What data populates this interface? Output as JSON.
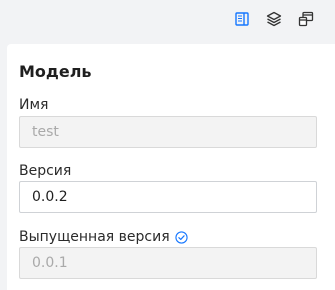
{
  "toolbar": {
    "buttons": [
      {
        "name": "panel-toggle-icon",
        "color": "#1677ff"
      },
      {
        "name": "layers-icon",
        "color": "#333333"
      },
      {
        "name": "windows-icon",
        "color": "#333333"
      }
    ]
  },
  "panel": {
    "title": "Модель",
    "fields": {
      "name": {
        "label": "Имя",
        "value": "test"
      },
      "version": {
        "label": "Версия",
        "value": "0.0.2"
      },
      "released_version": {
        "label": "Выпущенная версия",
        "value": "0.0.1"
      }
    }
  },
  "colors": {
    "accent": "#1677ff",
    "background": "#f2f3f5",
    "panel": "#ffffff"
  }
}
